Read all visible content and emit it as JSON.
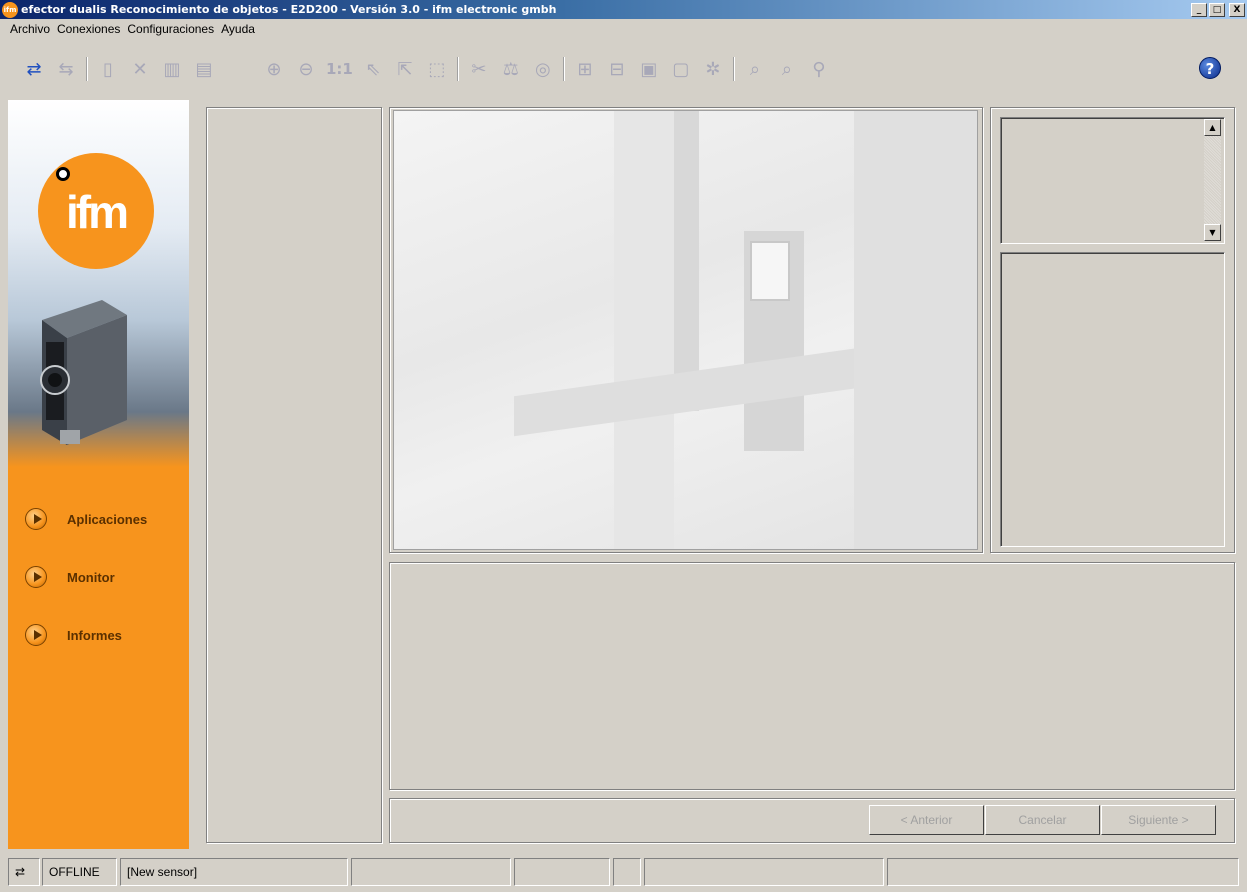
{
  "window": {
    "title": "efector dualis Reconocimiento de objetos - E2D200 - Versión 3.0 - ifm electronic gmbh",
    "app_icon_text": "ifm",
    "min_label": "_",
    "max_label": "□",
    "close_label": "X"
  },
  "menu": {
    "items": [
      {
        "label": "Archivo"
      },
      {
        "label": "Conexiones"
      },
      {
        "label": "Configuraciones"
      },
      {
        "label": "Ayuda"
      }
    ]
  },
  "toolbar": {
    "zoom_reset_label": "1:1",
    "help_label": "?",
    "icons": [
      "connect-icon",
      "disconnect-icon",
      "new-icon",
      "delete-icon",
      "upload-icon",
      "download-icon",
      "zoom-in-icon",
      "zoom-out-icon",
      "select-icon",
      "add-select-icon",
      "rectangle-select-icon",
      "cut-icon",
      "calibrate-icon",
      "trigger-icon",
      "add-model-icon",
      "remove-model-icon",
      "model-icon",
      "model-edit-icon",
      "model-settings-icon",
      "search-add-icon",
      "search-remove-icon",
      "filter-icon"
    ]
  },
  "sidebar": {
    "logo_text": "ifm",
    "nav": [
      {
        "label": "Aplicaciones"
      },
      {
        "label": "Monitor"
      },
      {
        "label": "Informes"
      }
    ]
  },
  "wizard": {
    "back_label": "< Anterior",
    "cancel_label": "Cancelar",
    "next_label": "Siguiente >"
  },
  "statusbar": {
    "connection": "OFFLINE",
    "sensor": "[New sensor]"
  },
  "colors": {
    "brand_orange": "#f7941d",
    "window_bg": "#d4d0c8",
    "titlebar_start": "#0a246a",
    "titlebar_end": "#a6caf0"
  }
}
